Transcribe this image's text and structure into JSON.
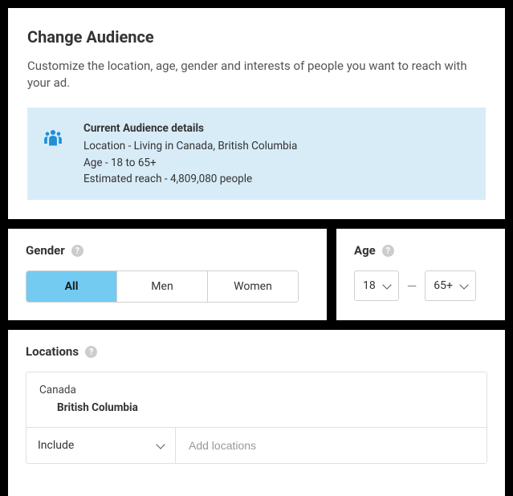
{
  "header": {
    "title": "Change Audience",
    "subtitle": "Customize the location, age, gender and interests of people you want to reach with your ad."
  },
  "current": {
    "title": "Current Audience details",
    "location": "Location - Living in Canada, British Columbia",
    "age": "Age - 18 to 65+",
    "reach": "Estimated reach - 4,809,080 people"
  },
  "gender": {
    "label": "Gender",
    "options": {
      "all": "All",
      "men": "Men",
      "women": "Women"
    }
  },
  "age": {
    "label": "Age",
    "min": "18",
    "max": "65+",
    "sep": "—"
  },
  "locations": {
    "label": "Locations",
    "country": "Canada",
    "region": "British Columbia",
    "include_label": "Include",
    "placeholder": "Add locations"
  },
  "help_glyph": "?"
}
